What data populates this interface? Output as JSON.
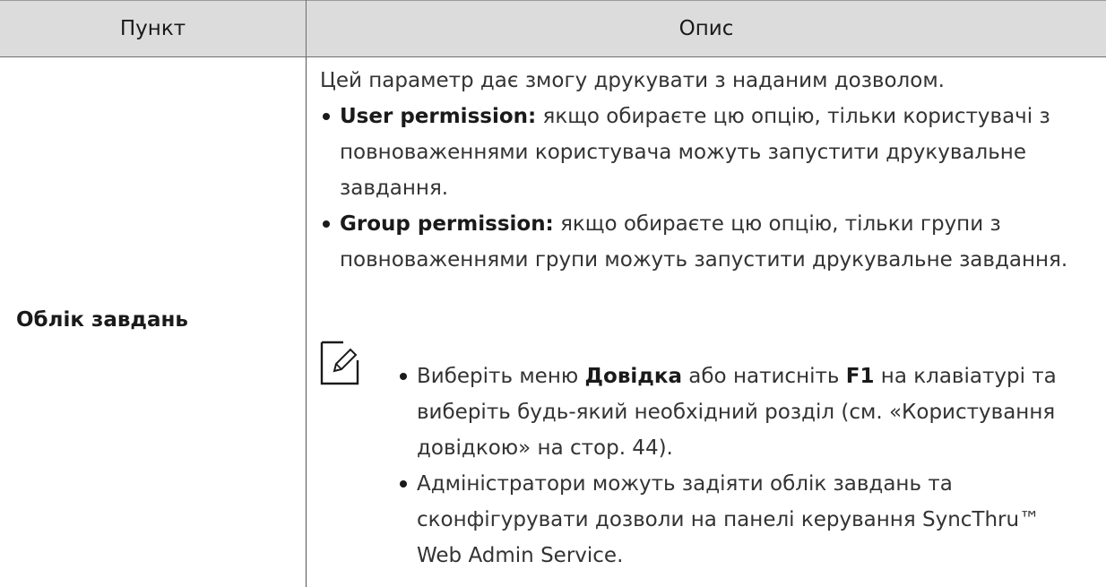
{
  "table": {
    "headers": {
      "item": "Пункт",
      "description": "Опис"
    },
    "row": {
      "item": "Облік завдань",
      "intro": "Цей параметр дає змогу друкувати з наданим дозволом.",
      "options": [
        {
          "term": "User permission:",
          "text": " якщо обираєте цю опцію, тільки користувачі з повноваженнями користувача можуть запустити друкувальне завдання."
        },
        {
          "term": "Group permission:",
          "text": " якщо обираєте цю опцію, тільки групи з повноваженнями групи можуть запустити друкувальне завдання."
        }
      ],
      "note": {
        "icon": "pencil-note-icon",
        "items": [
          {
            "p1": "Виберіть меню ",
            "b1": "Довідка",
            "p2": " або натисніть ",
            "b2": "F1",
            "p3": " на клавіатурі та виберіть будь-який необхідний розділ (см. «Користування довідкою» на стор. 44)."
          },
          {
            "text": "Адміністратори можуть задіяти облік завдань та сконфігурувати дозволи на панелі керування SyncThru™ Web Admin Service."
          }
        ]
      }
    }
  }
}
